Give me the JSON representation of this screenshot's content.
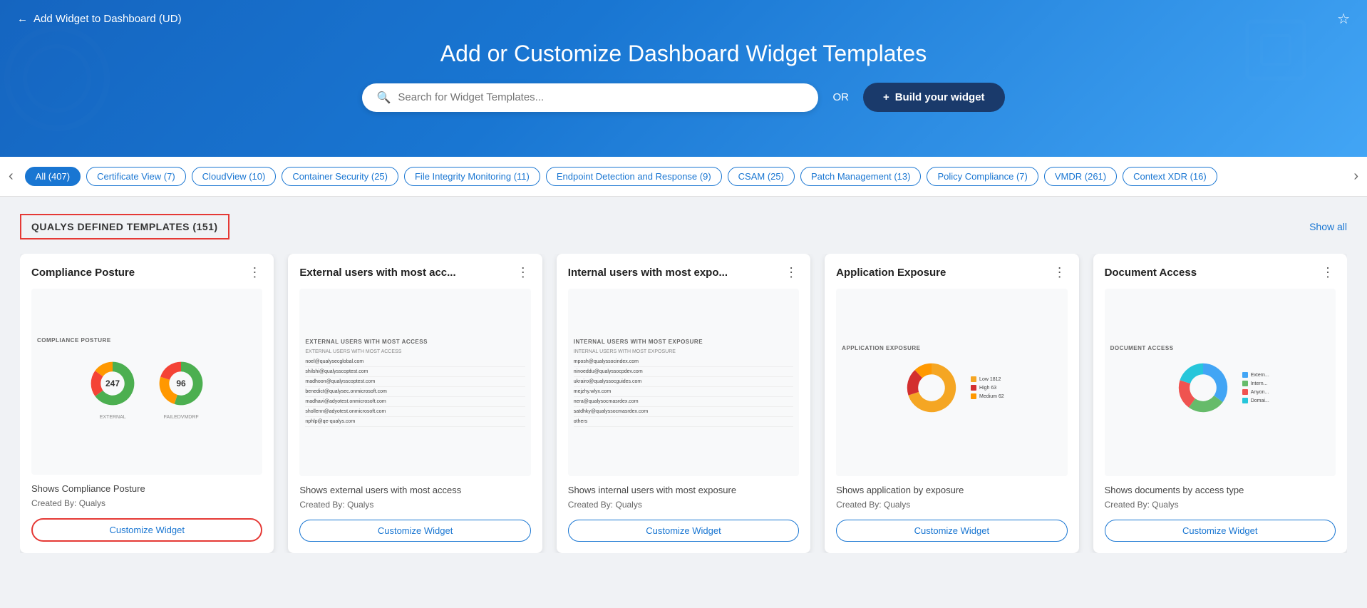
{
  "header": {
    "back_label": "Add Widget to Dashboard (UD)",
    "title": "Add or Customize Dashboard Widget Templates",
    "search_placeholder": "Search for Widget Templates...",
    "or_text": "OR",
    "build_btn": "Build your widget",
    "star": "☆"
  },
  "filter_tabs": [
    {
      "label": "All (407)",
      "active": true
    },
    {
      "label": "Certificate View (7)",
      "active": false
    },
    {
      "label": "CloudView (10)",
      "active": false
    },
    {
      "label": "Container Security (25)",
      "active": false
    },
    {
      "label": "File Integrity Monitoring (11)",
      "active": false
    },
    {
      "label": "Endpoint Detection and Response (9)",
      "active": false
    },
    {
      "label": "CSAM (25)",
      "active": false
    },
    {
      "label": "Patch Management (13)",
      "active": false
    },
    {
      "label": "Policy Compliance (7)",
      "active": false
    },
    {
      "label": "VMDR (261)",
      "active": false
    },
    {
      "label": "Context XDR (16)",
      "active": false
    }
  ],
  "section": {
    "title": "QUALYS DEFINED TEMPLATES (151)",
    "show_all": "Show all"
  },
  "cards": [
    {
      "title": "Compliance Posture",
      "menu": "⋮",
      "desc": "Shows Compliance Posture",
      "creator": "Created By: Qualys",
      "btn": "Customize Widget",
      "highlighted": true,
      "preview_type": "compliance"
    },
    {
      "title": "External users with most acc...",
      "menu": "⋮",
      "desc": "Shows external users with most access",
      "creator": "Created By: Qualys",
      "btn": "Customize Widget",
      "highlighted": false,
      "preview_type": "external_users"
    },
    {
      "title": "Internal users with most expo...",
      "menu": "⋮",
      "desc": "Shows internal users with most exposure",
      "creator": "Created By: Qualys",
      "btn": "Customize Widget",
      "highlighted": false,
      "preview_type": "internal_users"
    },
    {
      "title": "Application Exposure",
      "menu": "⋮",
      "desc": "Shows application by exposure",
      "creator": "Created By: Qualys",
      "btn": "Customize Widget",
      "highlighted": false,
      "preview_type": "app_exposure"
    },
    {
      "title": "Document Access",
      "menu": "⋮",
      "desc": "Shows documents by access type",
      "creator": "Created By: Qualys",
      "btn": "Customize Widget",
      "highlighted": false,
      "preview_type": "doc_access"
    }
  ],
  "compliance_preview": {
    "title": "COMPLIANCE POSTURE",
    "donut1_value": "247",
    "donut1_label": "EXTERNAL",
    "donut2_value": "96",
    "donut2_label": "FAILEDVMDRF"
  },
  "external_users_preview": {
    "title": "EXTERNAL USERS WITH MOST ACCESS",
    "subtitle": "EXTERNAL USERS WITH MOST ACCESS",
    "items": [
      "noel@qualysecglobal.com",
      "shilshi@qualysscoptest.com",
      "madhoon@qualysscoptest.com",
      "benedict@qualysec.onmicrosoft.com",
      "madhavi@adyotest.onmicrosoft.com",
      "shollenn@adyotest.onmicrosoft.com",
      "nphlp@qe-qualys.com"
    ]
  },
  "internal_users_preview": {
    "title": "INTERNAL USERS WITH MOST EXPOSURE",
    "subtitle": "INTERNAL USERS WITH MOST EXPOSURE",
    "items": [
      "mposh@qualyssocindex.com",
      "ninoeddu@qualyssocpdev.com",
      "ukrairo@qualyssocguides.com",
      "mejzhy.wlyx.com",
      "nera@qualysocmasrdex.com",
      "satdhky@qualyssocmasrdex.com",
      "others"
    ]
  },
  "app_exposure_preview": {
    "title": "APPLICATION EXPOSURE",
    "legend": [
      {
        "label": "Low",
        "value": "1812",
        "color": "#f5a623"
      },
      {
        "label": "High",
        "value": "63",
        "color": "#d32f2f"
      },
      {
        "label": "Medium",
        "value": "62",
        "color": "#ff9800"
      }
    ]
  },
  "doc_access_preview": {
    "title": "DOCUMENT ACCESS",
    "legend": [
      {
        "label": "Extern...",
        "color": "#42a5f5"
      },
      {
        "label": "Intern...",
        "color": "#66bb6a"
      },
      {
        "label": "Anyon...",
        "color": "#ef5350"
      },
      {
        "label": "Domai...",
        "color": "#26c6da"
      }
    ]
  }
}
